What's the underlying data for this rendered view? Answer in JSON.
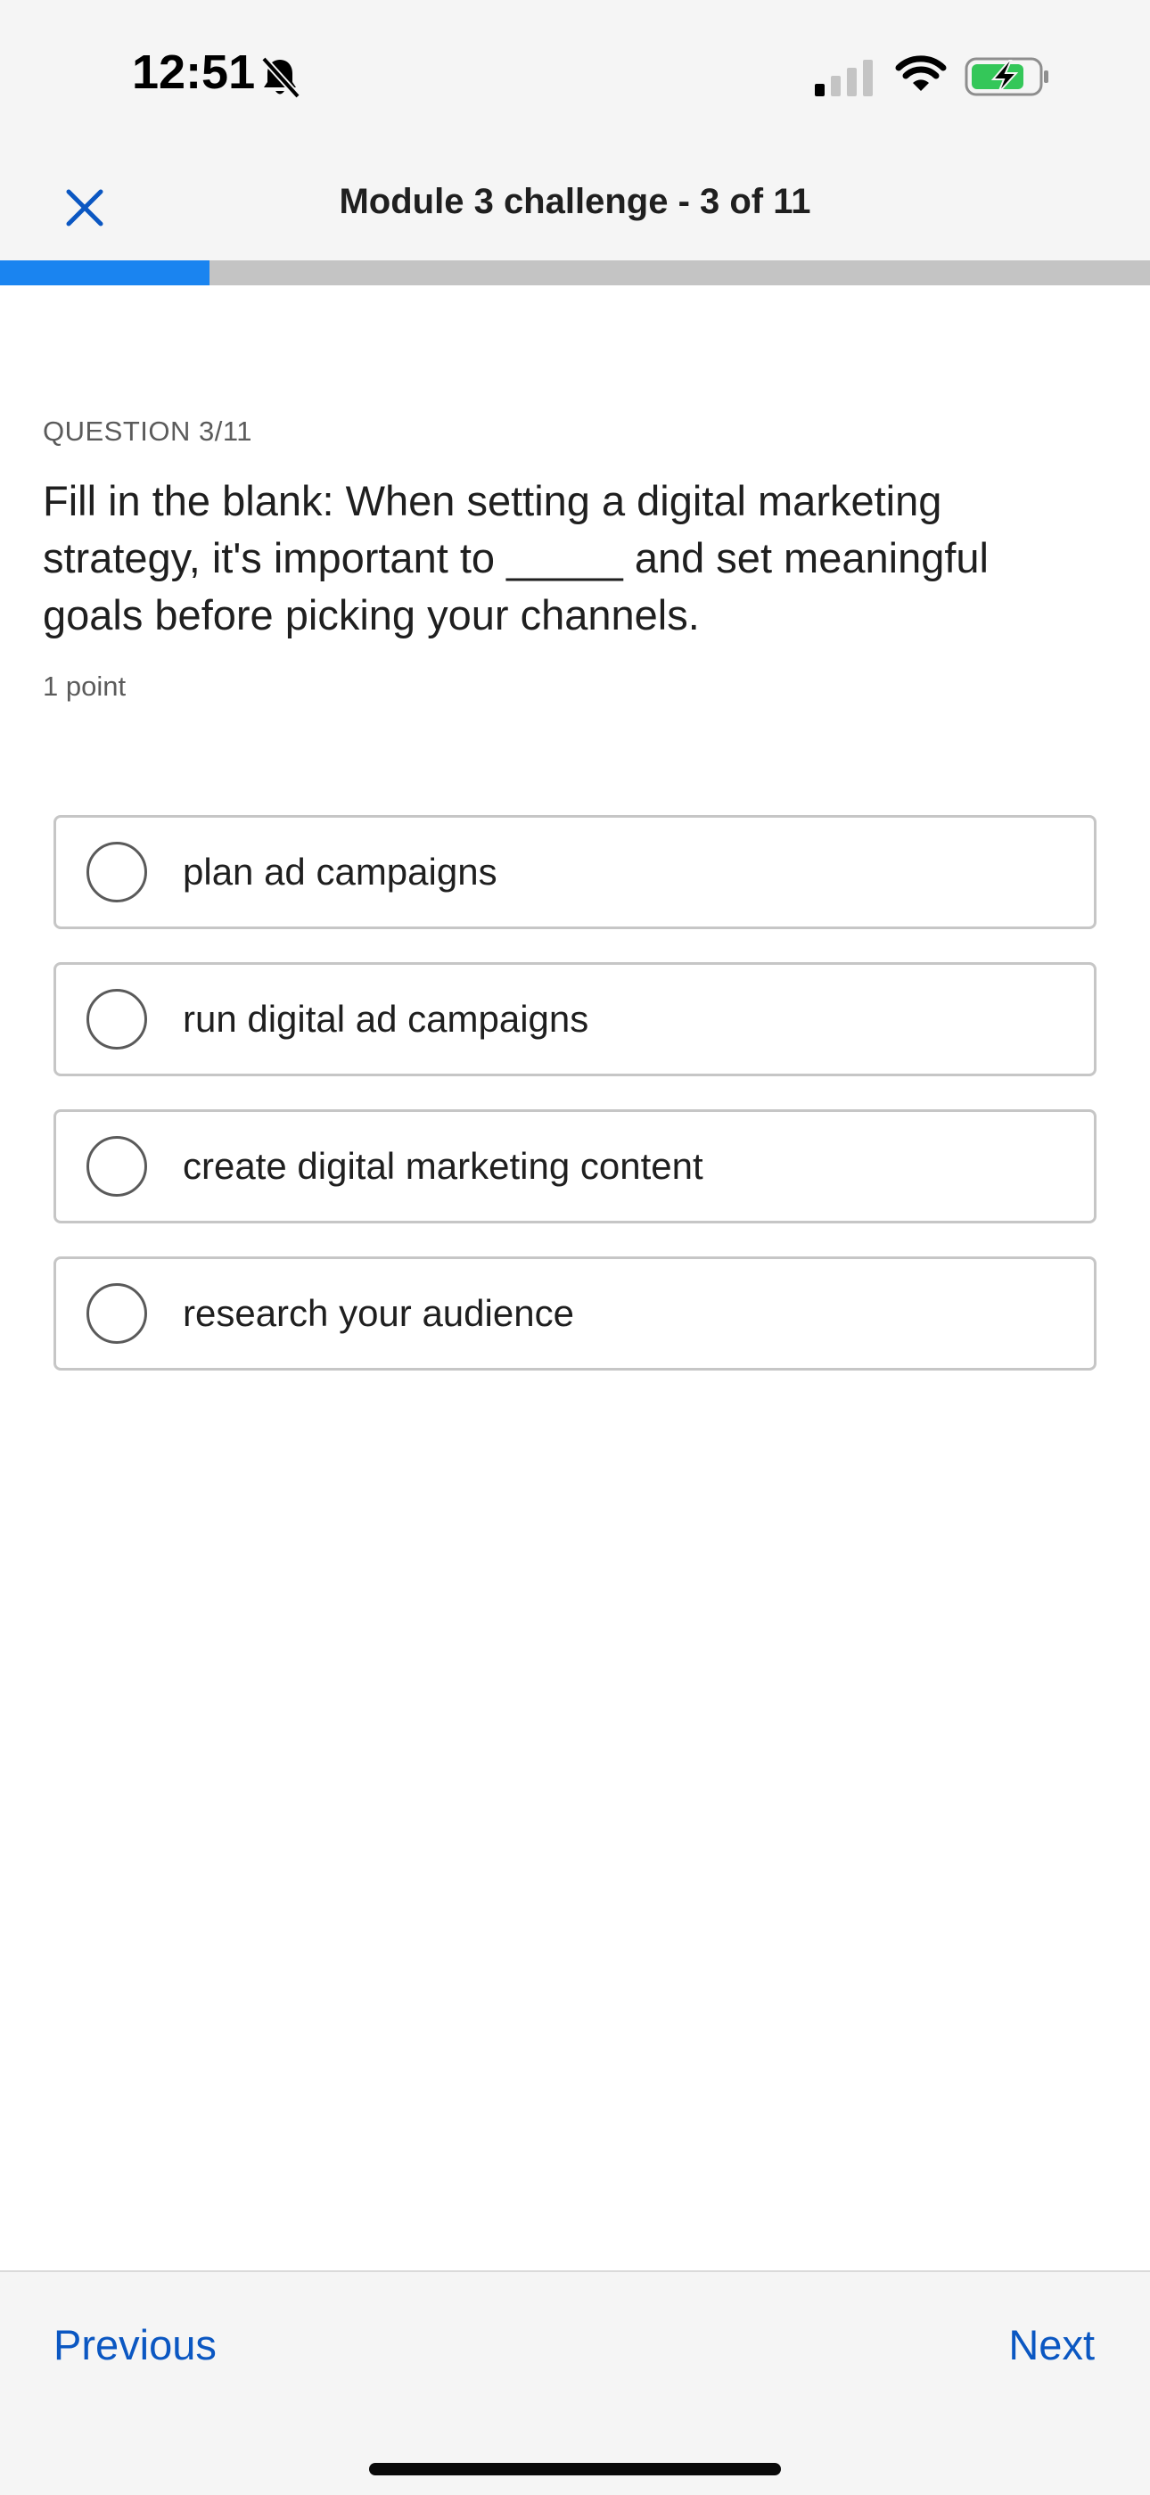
{
  "status_bar": {
    "time": "12:51",
    "icons": [
      "bell-slash-icon",
      "cellular-signal-icon",
      "wifi-icon",
      "battery-charging-icon"
    ],
    "battery_color": "#34c759"
  },
  "header": {
    "title": "Module 3 challenge - 3 of 11",
    "close_icon": "close-icon"
  },
  "progress": {
    "current": 3,
    "total": 11,
    "fraction": 0.1818,
    "fill_color": "#1a84f0",
    "track_color": "#c4c4c4"
  },
  "question": {
    "label": "QUESTION 3/11",
    "text": "Fill in the blank: When setting a digital marketing strategy, it's important to _____ and set meaningful goals before picking your channels.",
    "points": "1 point"
  },
  "options": [
    {
      "label": "plan ad campaigns",
      "selected": false
    },
    {
      "label": "run digital ad campaigns",
      "selected": false
    },
    {
      "label": "create digital marketing content",
      "selected": false
    },
    {
      "label": "research your audience",
      "selected": false
    }
  ],
  "footer": {
    "previous_label": "Previous",
    "next_label": "Next",
    "link_color": "#0b57c2"
  }
}
